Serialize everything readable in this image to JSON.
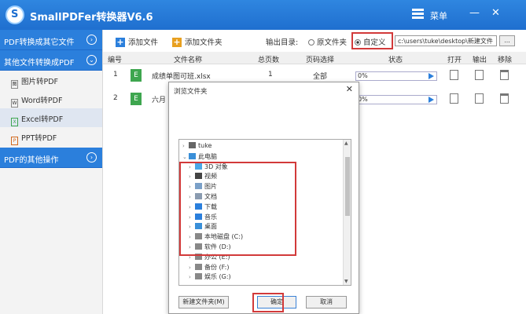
{
  "app": {
    "title": "SmallPDFer转换器V6.6",
    "logo_letter": "S",
    "menu_label": "菜单",
    "minimize": "—",
    "close": "✕"
  },
  "sidebar": {
    "section1": "PDF转换成其它文件",
    "section1_chev": "›",
    "section2": "其他文件转换成PDF",
    "section2_chev": "⌄",
    "items": [
      {
        "label": "图片转PDF",
        "icon": "图"
      },
      {
        "label": "Word转PDF",
        "icon": "W"
      },
      {
        "label": "Excel转PDF",
        "icon": "X"
      },
      {
        "label": "PPT转PDF",
        "icon": "P"
      }
    ],
    "section3": "PDF的其他操作",
    "section3_chev": "›"
  },
  "toolbar": {
    "add_file": "添加文件",
    "add_folder": "添加文件夹",
    "output_label": "输出目录:",
    "opt_original": "原文件夹",
    "opt_custom": "自定义",
    "path": "c:\\users\\tuke\\desktop\\新建文件",
    "browse": "..."
  },
  "table": {
    "headers": [
      "编号",
      "文件名称",
      "总页数",
      "页码选择",
      "状态",
      "打开",
      "输出",
      "移除"
    ],
    "rows": [
      {
        "num": "1",
        "file": "成绩单图可班.xlsx",
        "pages": "1",
        "range": "全部",
        "progress": "0%"
      },
      {
        "num": "2",
        "file": "六月",
        "pages": "",
        "range": "",
        "progress": "0%"
      }
    ]
  },
  "dialog": {
    "title": "浏览文件夹",
    "close": "✕",
    "tree": [
      {
        "label": "tuke",
        "icon": "user",
        "level": 0,
        "arrow": "›"
      },
      {
        "label": "此电脑",
        "icon": "pc",
        "level": 0,
        "arrow": "⌄"
      },
      {
        "label": "3D 对象",
        "icon": "folder3d",
        "level": 1,
        "arrow": "›"
      },
      {
        "label": "视频",
        "icon": "video",
        "level": 1,
        "arrow": "›"
      },
      {
        "label": "图片",
        "icon": "picture",
        "level": 1,
        "arrow": "›"
      },
      {
        "label": "文档",
        "icon": "doc",
        "level": 1,
        "arrow": "›"
      },
      {
        "label": "下载",
        "icon": "download",
        "level": 1,
        "arrow": "›"
      },
      {
        "label": "音乐",
        "icon": "music",
        "level": 1,
        "arrow": "›"
      },
      {
        "label": "桌面",
        "icon": "desktop",
        "level": 1,
        "arrow": "›"
      },
      {
        "label": "本地磁盘 (C:)",
        "icon": "drive",
        "level": 1,
        "arrow": "›"
      },
      {
        "label": "软件 (D:)",
        "icon": "drive",
        "level": 1,
        "arrow": "›"
      },
      {
        "label": "办公 (E:)",
        "icon": "drive",
        "level": 1,
        "arrow": "›"
      },
      {
        "label": "备份 (F:)",
        "icon": "drive",
        "level": 1,
        "arrow": "›"
      },
      {
        "label": "娱乐 (G:)",
        "icon": "drive",
        "level": 1,
        "arrow": "›"
      }
    ],
    "new_folder": "新建文件夹(M)",
    "ok": "确定",
    "cancel": "取消"
  },
  "colors": {
    "accent": "#2b7fdc",
    "highlight": "#d23a3a",
    "excel": "#3ea64f"
  }
}
